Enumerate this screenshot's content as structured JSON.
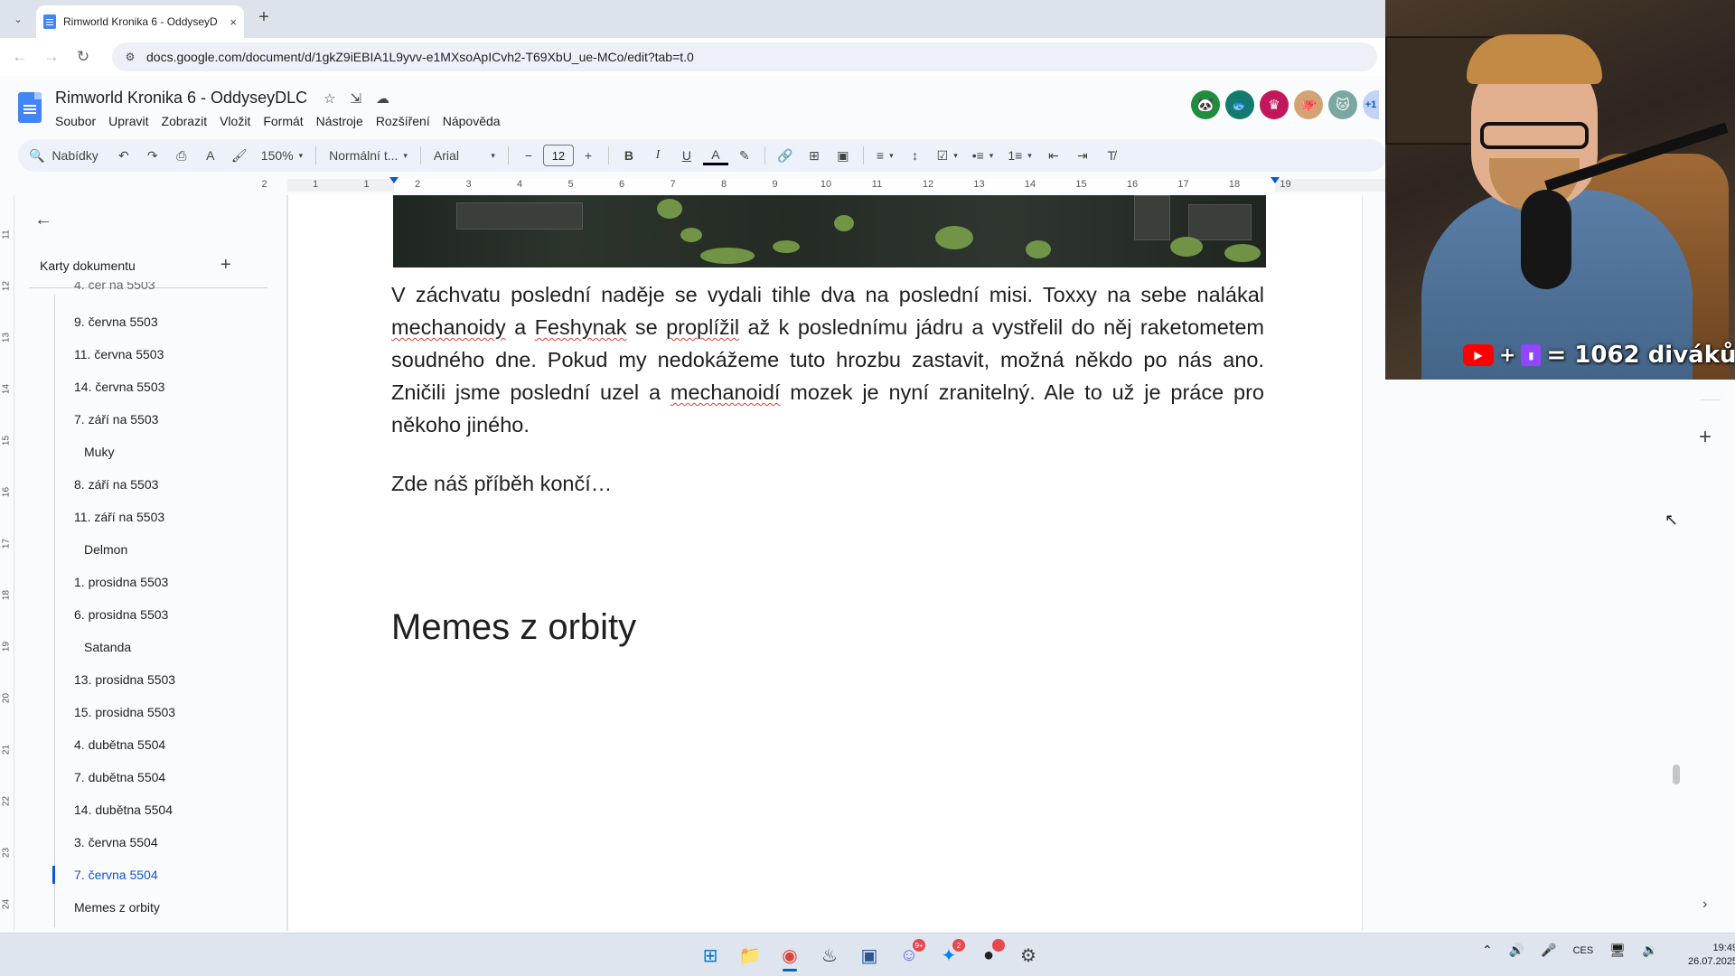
{
  "browser": {
    "tab_title": "Rimworld Kronika 6 - OddyseyD",
    "tab_close_icon": "×",
    "new_tab_icon": "+",
    "tab_list_icon": "⌄",
    "back_icon": "←",
    "forward_icon": "→",
    "reload_icon": "↻",
    "site_info_icon": "⚙",
    "url": "docs.google.com/document/d/1gkZ9iEBIA1L9yvv-e1MXsoApICvh2-T69XbU_ue-MCo/edit?tab=t.0"
  },
  "docs": {
    "title": "Rimworld Kronika 6 - OddyseyDLC",
    "star_icon": "☆",
    "move_icon": "⇲",
    "cloud_icon": "☁",
    "menu": [
      "Soubor",
      "Upravit",
      "Zobrazit",
      "Vložit",
      "Formát",
      "Nástroje",
      "Rozšíření",
      "Nápověda"
    ],
    "avatars": [
      {
        "glyph": "🐼",
        "color": "#1e8e3e"
      },
      {
        "glyph": "🐟",
        "color": "#137a6e"
      },
      {
        "glyph": "♛",
        "color": "#c2185b"
      },
      {
        "glyph": "🐙",
        "color": "#d4a373"
      },
      {
        "glyph": "🐱",
        "color": "#7aa7a0"
      }
    ],
    "avatars_more": "+1"
  },
  "format_toolbar": {
    "search_label": "Nabídky",
    "search_icon": "🔍",
    "undo_icon": "↶",
    "redo_icon": "↷",
    "print_icon": "⎙",
    "spell_icon": "A",
    "paint_icon": "🖌",
    "zoom": "150%",
    "style": "Normální t...",
    "font": "Arial",
    "minus": "−",
    "font_size": "12",
    "plus": "+",
    "bold": "B",
    "italic": "I",
    "underline": "U",
    "text_color": "A",
    "highlight_icon": "✎",
    "link_icon": "🔗",
    "comment_icon": "⊞",
    "image_icon": "▣",
    "align_icon": "≡",
    "spacing_icon": "↕",
    "checklist_icon": "☑",
    "bullets_icon": "•≡",
    "numbered_icon": "1≡",
    "indent_less_icon": "⇤",
    "indent_more_icon": "⇥",
    "clear_format_icon": "T̸",
    "caret": "▾"
  },
  "ruler": {
    "h_ticks": [
      "2",
      "1",
      "1",
      "2",
      "3",
      "4",
      "5",
      "6",
      "7",
      "8",
      "9",
      "10",
      "11",
      "12",
      "13",
      "14",
      "15",
      "16",
      "17",
      "18",
      "19"
    ],
    "v_ticks": [
      "11",
      "12",
      "13",
      "14",
      "15",
      "16",
      "17",
      "18",
      "19",
      "20",
      "21",
      "22",
      "23",
      "24"
    ]
  },
  "sidebar": {
    "back_icon": "←",
    "tabs_label": "Karty dokumentu",
    "add_icon": "+",
    "partial_item": "4. čer na 5503",
    "items": [
      {
        "label": "9. června 5503",
        "sub": false
      },
      {
        "label": "11. června 5503",
        "sub": false
      },
      {
        "label": "14. června 5503",
        "sub": false
      },
      {
        "label": "7. září na 5503",
        "sub": false
      },
      {
        "label": "Muky",
        "sub": true
      },
      {
        "label": "8. září na 5503",
        "sub": false
      },
      {
        "label": "11. září na 5503",
        "sub": false
      },
      {
        "label": "Delmon",
        "sub": true
      },
      {
        "label": "1. prosidna 5503",
        "sub": false
      },
      {
        "label": "6. prosidna 5503",
        "sub": false
      },
      {
        "label": "Satanda",
        "sub": true
      },
      {
        "label": "13. prosidna 5503",
        "sub": false
      },
      {
        "label": "15. prosidna 5503",
        "sub": false
      },
      {
        "label": "4. dubětna 5504",
        "sub": false
      },
      {
        "label": "7. dubětna 5504",
        "sub": false
      },
      {
        "label": "14. dubětna 5504",
        "sub": false
      },
      {
        "label": "3. června 5504",
        "sub": false
      },
      {
        "label": "7. června 5504",
        "sub": false,
        "active": true
      },
      {
        "label": "Memes z orbity",
        "sub": false
      }
    ]
  },
  "document": {
    "paragraph": {
      "t1": "V záchvatu poslední naděje se vydali tihle dva na poslední misi. Toxxy na sebe nalákal ",
      "s1": "mechanoidy",
      "t2": " a ",
      "s2": "Feshynak",
      "t3": " se ",
      "s3": "proplížil",
      "t4": " až k poslednímu jádru a vystřelil do něj raketometem soudného dne. Pokud my nedokážeme tuto hrozbu zastavit, možná někdo po nás ano. Zničili jsme poslední uzel a ",
      "s4": "mechanoidí",
      "t5": " mozek je nyní zranitelný. Ale to už je práce pro někoho jiného."
    },
    "ending": "Zde náš příběh končí…",
    "heading": "Memes z orbity"
  },
  "right_rail": {
    "plus_icon": "+",
    "chevron_icon": "›",
    "cursor_icon": "↖"
  },
  "webcam": {
    "plus": "+",
    "yt_icon": "▶",
    "tw_icon": "▮",
    "viewers": "= 1062 diváků"
  },
  "taskbar": {
    "icons": [
      {
        "name": "windows-start-icon",
        "glyph": "⊞",
        "color": "#0078d4"
      },
      {
        "name": "file-explorer-icon",
        "glyph": "📁",
        "color": "#f2b600"
      },
      {
        "name": "chrome-icon",
        "glyph": "◉",
        "color": "#db4437",
        "active": true
      },
      {
        "name": "steam-icon",
        "glyph": "♨",
        "color": "#1b2838"
      },
      {
        "name": "window-app-icon",
        "glyph": "▣",
        "color": "#2b579a"
      },
      {
        "name": "discord-icon",
        "glyph": "☺",
        "color": "#5865f2",
        "badge": "9+"
      },
      {
        "name": "messenger-icon",
        "glyph": "✦",
        "color": "#0084ff",
        "badge": "2"
      },
      {
        "name": "obs-icon",
        "glyph": "●",
        "color": "#222222",
        "badge": " "
      },
      {
        "name": "settings-app-icon",
        "glyph": "⚙",
        "color": "#444444"
      }
    ],
    "tray": {
      "chevron": "⌃",
      "speaker": "🔊",
      "mic": "🎤",
      "lang": "CES",
      "network": "🖥",
      "volume": "🔉"
    },
    "time": "19:49",
    "date": "26.07.2025"
  }
}
